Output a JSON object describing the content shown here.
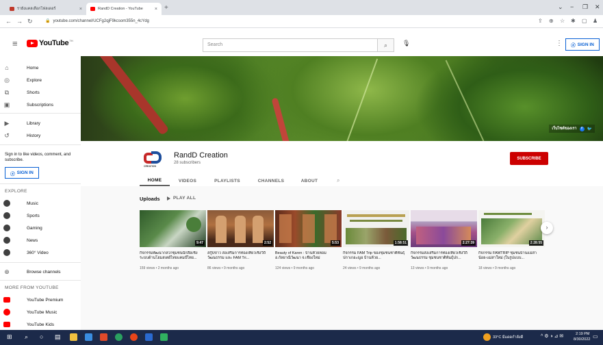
{
  "browser": {
    "tabs": [
      {
        "title": "รายังแคลเลือกโฟลเดอร์"
      },
      {
        "title": "RandD Creation - YouTube"
      }
    ],
    "new_tab": "+",
    "url": "youtube.com/channel/UCFg2qjF9kcsom355n_4cYdg"
  },
  "header": {
    "logo_text": "YouTube",
    "logo_tm": "TH",
    "search_placeholder": "Search",
    "signin_label": "SIGN IN"
  },
  "sidebar": {
    "main": [
      {
        "label": "Home",
        "icon": "home-icon"
      },
      {
        "label": "Explore",
        "icon": "compass-icon"
      },
      {
        "label": "Shorts",
        "icon": "shorts-icon"
      },
      {
        "label": "Subscriptions",
        "icon": "subscriptions-icon"
      }
    ],
    "library": [
      {
        "label": "Library",
        "icon": "library-icon"
      },
      {
        "label": "History",
        "icon": "history-icon"
      }
    ],
    "signin_note": "Sign in to like videos, comment, and subscribe.",
    "signin_label": "SIGN IN",
    "explore_heading": "EXPLORE",
    "explore": [
      {
        "label": "Music"
      },
      {
        "label": "Sports"
      },
      {
        "label": "Gaming"
      },
      {
        "label": "News"
      },
      {
        "label": "360° Video"
      }
    ],
    "browse_channels": "Browse channels",
    "more_heading": "MORE FROM YOUTUBE",
    "more": [
      {
        "label": "YouTube Premium"
      },
      {
        "label": "YouTube Music"
      },
      {
        "label": "YouTube Kids"
      }
    ]
  },
  "banner": {
    "link_text": "เว็บไซต์ของเรา"
  },
  "channel": {
    "avatar_caption": "CREATION",
    "name": "RandD Creation",
    "subscribers": "28 subscribers",
    "subscribe_label": "SUBSCRIBE",
    "tabs": [
      {
        "label": "HOME",
        "active": true
      },
      {
        "label": "VIDEOS"
      },
      {
        "label": "PLAYLISTS"
      },
      {
        "label": "CHANNELS"
      },
      {
        "label": "ABOUT"
      }
    ]
  },
  "uploads": {
    "title": "Uploads",
    "play_all": "PLAY ALL",
    "videos": [
      {
        "title": "กิจกรรมพัฒนากลไกชุมชนนักสื่อเชิงระบบด้านโฮมสเตย์ไทยแคมป์ไทย...",
        "duration": "9:47",
        "meta": "159 views • 2 months ago"
      },
      {
        "title": "สกู๊ปข่าว ส่งเสริมการท่องเที่ยวเชิงวิถีวัฒนธรรม และ FAM Tri...",
        "duration": "2:52",
        "meta": "86 views • 9 months ago"
      },
      {
        "title": "Beauty of Karen : บ้านห้วยหอม อ.กัลยาณิวัฒนา จ.เชียงใหม่",
        "duration": "5:53",
        "meta": "124 views • 9 months ago"
      },
      {
        "title": "กิจกรรม FAM Trip ของชุมชนชาติพันธุ์ปกาเกอะญอ บ้านห้วย...",
        "duration": "1:58:51",
        "meta": "24 views • 9 months ago"
      },
      {
        "title": "กิจกรรมส่งเสริมการท่องเที่ยวเชิงวิถีวัฒนธรรม ชุมชนชาติพันธุ์ปก...",
        "duration": "2:27:39",
        "meta": "13 views • 9 months ago"
      },
      {
        "title": "กิจกรรม FAMTRIP ชุมชนบ้านแม่สาน้อย-แม่สาใหม่ (ในรูปแบบ...",
        "duration": "2:28:55",
        "meta": "18 views • 9 months ago"
      }
    ]
  },
  "taskbar": {
    "weather": "33°C มีแดดกำลังดี",
    "time": "2:19 PM",
    "date": "8/30/2022"
  }
}
